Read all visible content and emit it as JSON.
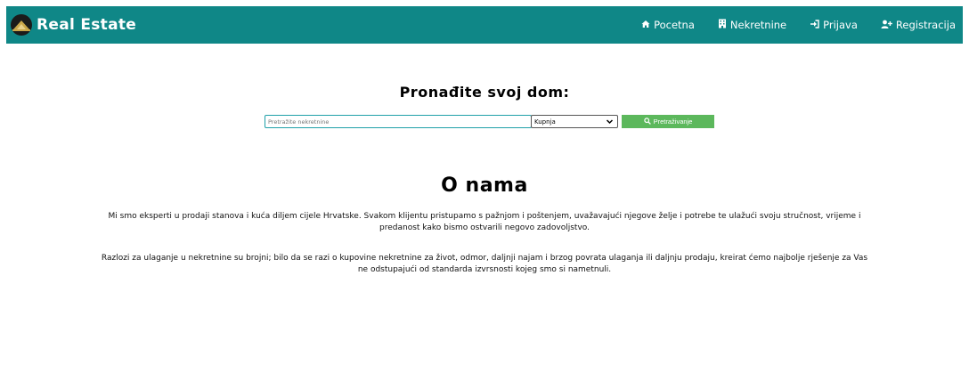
{
  "brand": {
    "title": "Real Estate"
  },
  "nav": {
    "items": [
      {
        "label": "Pocetna",
        "icon": "home-icon"
      },
      {
        "label": "Nekretnine",
        "icon": "building-icon"
      },
      {
        "label": "Prijava",
        "icon": "sign-in-icon"
      },
      {
        "label": "Registracija",
        "icon": "user-plus-icon"
      }
    ]
  },
  "search": {
    "title": "Pronađite svoj dom:",
    "placeholder": "Pretražite nekretnine",
    "select_value": "Kupnja",
    "button_label": "Pretraživanje"
  },
  "about": {
    "title": "O nama",
    "paragraphs": [
      "Mi smo eksperti u prodaji stanova i kuća diljem cijele Hrvatske. Svakom klijentu pristupamo s pažnjom i poštenjem, uvažavajući njegove želje i potrebe te ulažući svoju stručnost, vrijeme i predanost kako bismo ostvarili negovo zadovoljstvo.",
      "Razlozi za ulaganje u nekretnine su brojni; bilo da se razi o kupovine nekretnine za život, odmor, daljnji najam i brzog povrata ulaganja ili daljnju prodaju, kreirat ćemo najbolje rješenje za Vas ne odstupajući od standarda izvrsnosti kojeg smo si nametnuli."
    ]
  },
  "colors": {
    "navbar": "#0f8787",
    "search_button": "#5cb85c",
    "input_border": "#1fa0a8"
  }
}
